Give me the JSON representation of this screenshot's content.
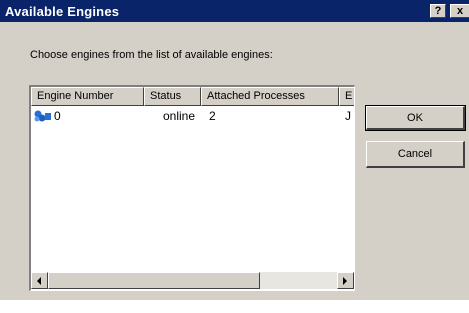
{
  "dialog": {
    "title": "Available Engines",
    "help_label": "?",
    "close_label": "x",
    "instruction": "Choose engines from the list of available engines:",
    "ok_label": "OK",
    "cancel_label": "Cancel"
  },
  "list": {
    "columns": [
      "Engine Number",
      "Status",
      "Attached Processes",
      "E"
    ],
    "rows": [
      {
        "icon": "engine-icon",
        "engine_number": "0",
        "status": "online",
        "attached_processes": "2",
        "extra": "J"
      }
    ]
  },
  "colors": {
    "titlebar": "#0a246a",
    "dialog_face": "#d4d0c8",
    "icon_blue": "#2a6fd6"
  }
}
